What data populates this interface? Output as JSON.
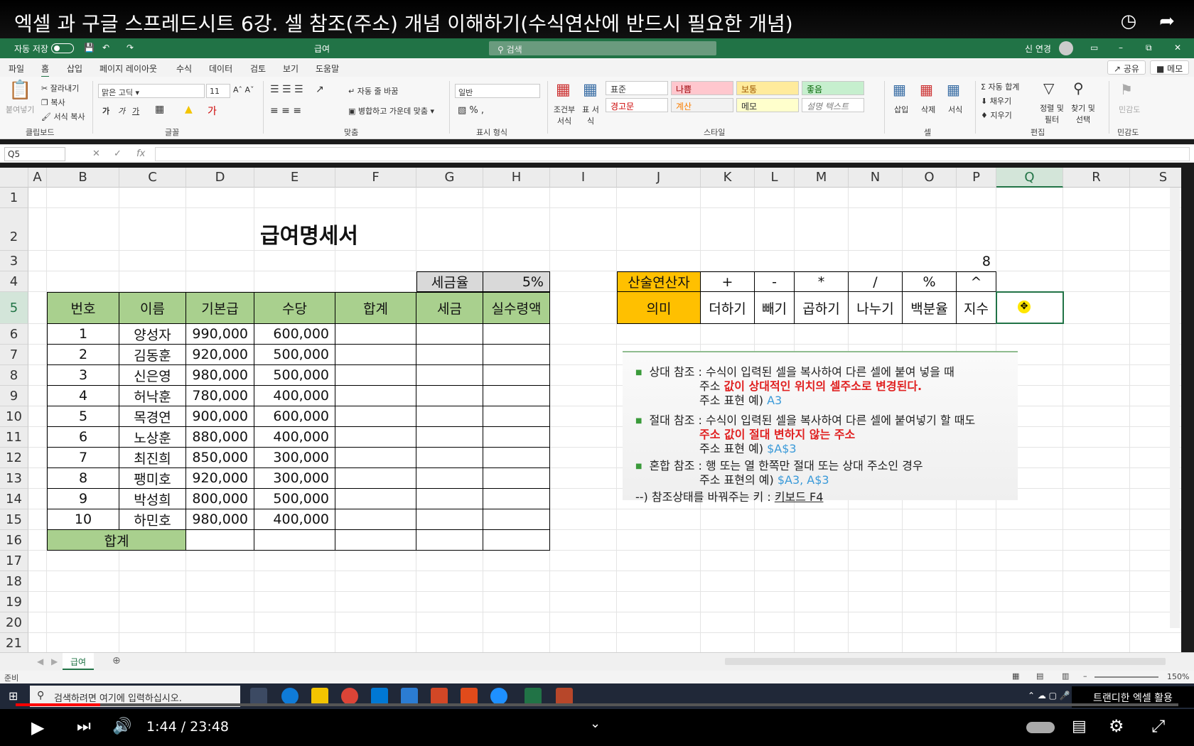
{
  "video": {
    "title": "엑셀 과 구글 스프레드시트 6강. 셀 참조(주소) 개념 이해하기(수식연산에 반드시 필요한 개념)",
    "time": "1:44 / 23:48",
    "channel_badge": "트랜디한 엑셀 활용",
    "played_fraction": 0.073
  },
  "excel": {
    "autosave": "자동 저장",
    "toggle": "끔",
    "file_name": "급여",
    "search_placeholder": "검색",
    "user": "신 연경",
    "tabs": [
      "파일",
      "홈",
      "삽입",
      "페이지 레이아웃",
      "수식",
      "데이터",
      "검토",
      "보기",
      "도움말"
    ],
    "share": "공유",
    "memo": "메모",
    "ribbon": {
      "clipboard": {
        "paste": "붙여넣기",
        "cut": "잘라내기",
        "copy": "복사",
        "format_painter": "서식 복사",
        "label": "클립보드"
      },
      "font": {
        "name": "맑은 고딕",
        "size": "11",
        "label": "글꼴"
      },
      "align": {
        "wrap": "자동 줄 바꿈",
        "merge": "병합하고 가운데 맞춤",
        "label": "맞춤"
      },
      "number": {
        "format": "일반",
        "label": "표시 형식"
      },
      "styles": {
        "cond": "조건부 서식",
        "table": "표 서식",
        "cells": [
          "표준",
          "나쁨",
          "보통",
          "좋음",
          "경고문",
          "계산",
          "메모",
          "설명 텍스트"
        ],
        "label": "스타일"
      },
      "cells": {
        "insert": "삽입",
        "delete": "삭제",
        "format": "서식",
        "label": "셀"
      },
      "edit": {
        "autosum": "자동 합계",
        "fill": "채우기",
        "clear": "지우기",
        "sort": "정렬 및 필터",
        "find": "찾기 및 선택",
        "label": "편집"
      },
      "sensitivity": {
        "name": "민감도",
        "label": "민감도"
      }
    },
    "name_box": "Q5",
    "columns": [
      "A",
      "B",
      "C",
      "D",
      "E",
      "F",
      "G",
      "H",
      "I",
      "J",
      "K",
      "L",
      "M",
      "N",
      "O",
      "P",
      "Q",
      "R",
      "S"
    ],
    "rows": [
      "1",
      "2",
      "3",
      "4",
      "5",
      "6",
      "7",
      "8",
      "9",
      "10",
      "11",
      "12",
      "13",
      "14",
      "15",
      "16",
      "17",
      "18",
      "19",
      "20",
      "21"
    ],
    "sheet": {
      "title": "급여명세서",
      "tax_label": "세금율",
      "tax_rate": "5%",
      "headers": [
        "번호",
        "이름",
        "기본급",
        "수당",
        "합계",
        "세금",
        "실수령액"
      ],
      "data": [
        [
          "1",
          "양성자",
          "990,000",
          "600,000"
        ],
        [
          "2",
          "김동훈",
          "920,000",
          "500,000"
        ],
        [
          "3",
          "신은영",
          "980,000",
          "500,000"
        ],
        [
          "4",
          "허낙훈",
          "780,000",
          "400,000"
        ],
        [
          "5",
          "목경연",
          "900,000",
          "600,000"
        ],
        [
          "6",
          "노상훈",
          "880,000",
          "400,000"
        ],
        [
          "7",
          "최진희",
          "850,000",
          "300,000"
        ],
        [
          "8",
          "팽미호",
          "920,000",
          "300,000"
        ],
        [
          "9",
          "박성희",
          "800,000",
          "500,000"
        ],
        [
          "10",
          "하민호",
          "980,000",
          "400,000"
        ]
      ],
      "total_label": "합계",
      "p3_value": "8",
      "operators": {
        "label1": "산술연산자",
        "label2": "의미",
        "symbols": [
          "+",
          "-",
          "*",
          "/",
          "%",
          "^"
        ],
        "meanings": [
          "더하기",
          "빼기",
          "곱하기",
          "나누기",
          "백분율",
          "지수"
        ]
      }
    },
    "note": {
      "l1": "상대 참조 : 수식이 입력된 셀을 복사하여 다른 셀에 붙여 넣을 때",
      "l2a": "주소 ",
      "l2b": "값이 상대적인 위치의 셀주소로 변경된다.",
      "l3a": "주소 표현 예) ",
      "l3b": "A3",
      "l4": "절대 참조 : 수식이 입력된 셀을 복사하여 다른 셀에 붙여넣기 할 때도",
      "l5": "주소 값이 절대 변하지 않는 주소",
      "l6a": "주소 표현 예) ",
      "l6b": "$A$3",
      "l7": "혼합 참조 : 행 또는 열 한쪽만 절대 또는 상대 주소인 경우",
      "l8a": "주소 표현의 예) ",
      "l8b": "$A3, A$3",
      "l9a": "--) 참조상태를 바꿔주는 키 : ",
      "l9b": "키보드 F4"
    },
    "sheet_tab": "급여",
    "status": "준비",
    "zoom": "150%"
  },
  "taskbar": {
    "search": "검색하려면 여기에 입력하십시오."
  }
}
